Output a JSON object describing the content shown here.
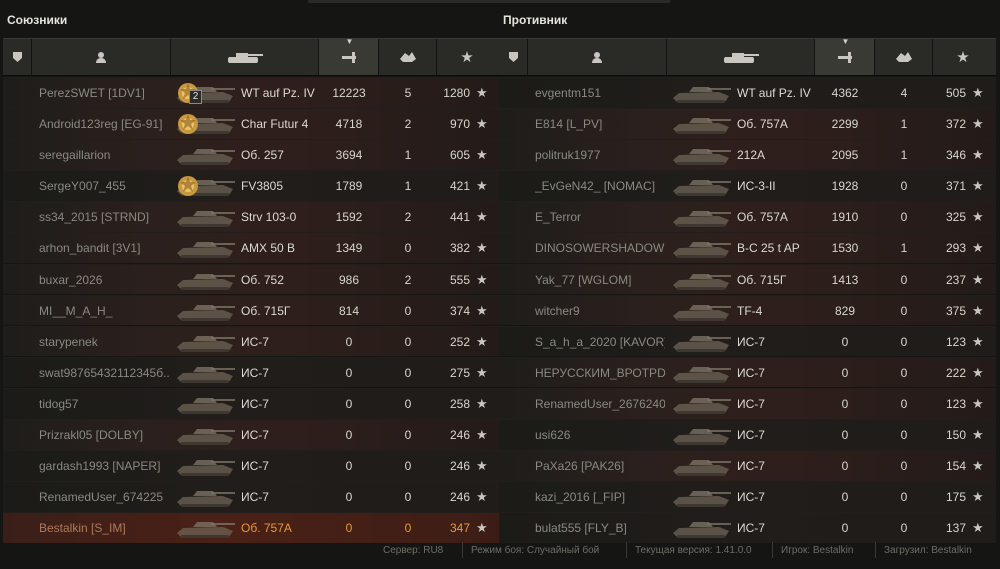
{
  "allies": {
    "title": "Союзники",
    "rows": [
      {
        "name": "PerezSWET [1DV1]",
        "tank": "WT auf Pz. IV",
        "damage": "12223",
        "frags": "5",
        "xp": "1280",
        "medal": "mark",
        "badge": "2"
      },
      {
        "name": "Android123reg [EG-91]",
        "tank": "Char Futur 4",
        "damage": "4718",
        "frags": "2",
        "xp": "970",
        "medal": "mark"
      },
      {
        "name": "seregaillarion",
        "tank": "Об. 257",
        "damage": "3694",
        "frags": "1",
        "xp": "605"
      },
      {
        "name": "SergeY007_455",
        "tank": "FV3805",
        "damage": "1789",
        "frags": "1",
        "xp": "421",
        "medal": "mark"
      },
      {
        "name": "ss34_2015 [STRND]",
        "tank": "Strv 103-0",
        "damage": "1592",
        "frags": "2",
        "xp": "441"
      },
      {
        "name": "arhon_bandit [3V1]",
        "tank": "AMX 50 B",
        "damage": "1349",
        "frags": "0",
        "xp": "382"
      },
      {
        "name": "buxar_2026",
        "tank": "Об. 752",
        "damage": "986",
        "frags": "2",
        "xp": "555"
      },
      {
        "name": "MI__M_A_H_",
        "tank": "Об. 715Г",
        "damage": "814",
        "frags": "0",
        "xp": "374"
      },
      {
        "name": "starypenek",
        "tank": "ИС-7",
        "damage": "0",
        "frags": "0",
        "xp": "252"
      },
      {
        "name": "swat98765432112345б...",
        "tank": "ИС-7",
        "damage": "0",
        "frags": "0",
        "xp": "275"
      },
      {
        "name": "tidog57",
        "tank": "ИС-7",
        "damage": "0",
        "frags": "0",
        "xp": "258"
      },
      {
        "name": "Prizrakl05 [DOLBY]",
        "tank": "ИС-7",
        "damage": "0",
        "frags": "0",
        "xp": "246"
      },
      {
        "name": "gardash1993 [NAPER]",
        "tank": "ИС-7",
        "damage": "0",
        "frags": "0",
        "xp": "246"
      },
      {
        "name": "RenamedUser_674225",
        "tank": "ИС-7",
        "damage": "0",
        "frags": "0",
        "xp": "246"
      },
      {
        "name": "Bestalkin [S_IM]",
        "tank": "Об. 757А",
        "damage": "0",
        "frags": "0",
        "xp": "347",
        "me": true
      }
    ]
  },
  "enemies": {
    "title": "Противник",
    "rows": [
      {
        "name": "evgentm151",
        "tank": "WT auf Pz. IV",
        "damage": "4362",
        "frags": "4",
        "xp": "505"
      },
      {
        "name": "E814 [L_PV]",
        "tank": "Об. 757А",
        "damage": "2299",
        "frags": "1",
        "xp": "372"
      },
      {
        "name": "politruk1977",
        "tank": "212А",
        "damage": "2095",
        "frags": "1",
        "xp": "346"
      },
      {
        "name": "_EvGeN42_ [NOMAC]",
        "tank": "ИС-3-II",
        "damage": "1928",
        "frags": "0",
        "xp": "371"
      },
      {
        "name": "E_Terror",
        "tank": "Об. 757А",
        "damage": "1910",
        "frags": "0",
        "xp": "325"
      },
      {
        "name": "DINOSOWERSHADOW",
        "tank": "В-С 25 t AP",
        "damage": "1530",
        "frags": "1",
        "xp": "293"
      },
      {
        "name": "Yak_77 [WGLOM]",
        "tank": "Об. 715Г",
        "damage": "1413",
        "frags": "0",
        "xp": "237"
      },
      {
        "name": "witcher9",
        "tank": "TF-4",
        "damage": "829",
        "frags": "0",
        "xp": "375"
      },
      {
        "name": "S_a_h_a_2020 [KAVOR]",
        "tank": "ИС-7",
        "damage": "0",
        "frags": "0",
        "xp": "123"
      },
      {
        "name": "НЕРУССКИМ_ВРОТРDАМ",
        "tank": "ИС-7",
        "damage": "0",
        "frags": "0",
        "xp": "222"
      },
      {
        "name": "RenamedUser_26762405",
        "tank": "ИС-7",
        "damage": "0",
        "frags": "0",
        "xp": "123"
      },
      {
        "name": "usi626",
        "tank": "ИС-7",
        "damage": "0",
        "frags": "0",
        "xp": "150"
      },
      {
        "name": "PaXa26 [PAK26]",
        "tank": "ИС-7",
        "damage": "0",
        "frags": "0",
        "xp": "154"
      },
      {
        "name": "kazi_2016 [_FIP]",
        "tank": "ИС-7",
        "damage": "0",
        "frags": "0",
        "xp": "175"
      },
      {
        "name": "bulat555 [FLY_B]",
        "tank": "ИС-7",
        "damage": "0",
        "frags": "0",
        "xp": "137"
      }
    ]
  },
  "footer": {
    "server": "Сервер: RU8",
    "mode": "Режим боя: Случайный бой",
    "version": "Текущая версия: 1.41.0.0",
    "player": "Игрок: Bestalkin",
    "uploader": "Загрузил: Bestalkin"
  },
  "colors": {
    "accent": "#e59a3a",
    "text": "#d8d6ce",
    "muted": "#8a8982"
  }
}
